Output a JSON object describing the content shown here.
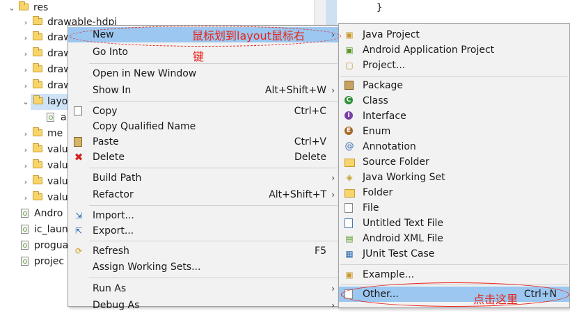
{
  "tree": {
    "items": [
      {
        "label": "res",
        "twisty": "⌄",
        "icon": "folder-icon"
      },
      {
        "label": "drawable-hdpi",
        "twisty": "›",
        "icon": "folder-icon"
      },
      {
        "label": "draw",
        "twisty": "",
        "icon": "folder-icon"
      },
      {
        "label": "draw",
        "twisty": "›",
        "icon": "folder-icon"
      },
      {
        "label": "draw",
        "twisty": "›",
        "icon": "folder-icon"
      },
      {
        "label": "draw",
        "twisty": "›",
        "icon": "folder-icon"
      },
      {
        "label": "layo",
        "twisty": "⌄",
        "icon": "folder-icon"
      },
      {
        "label": "a",
        "twisty": "",
        "icon": "xml-file-icon"
      },
      {
        "label": "me",
        "twisty": "›",
        "icon": "folder-icon"
      },
      {
        "label": "valu",
        "twisty": "›",
        "icon": "folder-icon"
      },
      {
        "label": "valu",
        "twisty": "›",
        "icon": "folder-icon"
      },
      {
        "label": "valu",
        "twisty": "›",
        "icon": "folder-icon"
      },
      {
        "label": "valu",
        "twisty": "›",
        "icon": "folder-icon"
      },
      {
        "label": "Andro",
        "twisty": "",
        "icon": "file-icon"
      },
      {
        "label": "ic_laun",
        "twisty": "",
        "icon": "file-icon"
      },
      {
        "label": "progua",
        "twisty": "",
        "icon": "file-icon"
      },
      {
        "label": "projec",
        "twisty": "",
        "icon": "file-icon"
      }
    ]
  },
  "editor": {
    "brace": "}"
  },
  "context_menu": {
    "items": [
      {
        "label": "New",
        "shortcut": "",
        "submenu": true,
        "icon": ""
      },
      {
        "label": "Go Into",
        "shortcut": "",
        "submenu": false,
        "icon": ""
      },
      {
        "label": "Open in New Window",
        "shortcut": "",
        "submenu": false,
        "icon": ""
      },
      {
        "label": "Show In",
        "shortcut": "Alt+Shift+W",
        "submenu": true,
        "icon": ""
      },
      {
        "label": "Copy",
        "shortcut": "Ctrl+C",
        "submenu": false,
        "icon": "copy-icon"
      },
      {
        "label": "Copy Qualified Name",
        "shortcut": "",
        "submenu": false,
        "icon": ""
      },
      {
        "label": "Paste",
        "shortcut": "Ctrl+V",
        "submenu": false,
        "icon": "paste-icon"
      },
      {
        "label": "Delete",
        "shortcut": "Delete",
        "submenu": false,
        "icon": "delete-icon"
      },
      {
        "label": "Build Path",
        "shortcut": "",
        "submenu": true,
        "icon": ""
      },
      {
        "label": "Refactor",
        "shortcut": "Alt+Shift+T",
        "submenu": true,
        "icon": ""
      },
      {
        "label": "Import...",
        "shortcut": "",
        "submenu": false,
        "icon": "import-icon"
      },
      {
        "label": "Export...",
        "shortcut": "",
        "submenu": false,
        "icon": "export-icon"
      },
      {
        "label": "Refresh",
        "shortcut": "F5",
        "submenu": false,
        "icon": "refresh-icon"
      },
      {
        "label": "Assign Working Sets...",
        "shortcut": "",
        "submenu": false,
        "icon": ""
      },
      {
        "label": "Run As",
        "shortcut": "",
        "submenu": true,
        "icon": ""
      },
      {
        "label": "Debug As",
        "shortcut": "",
        "submenu": true,
        "icon": ""
      }
    ]
  },
  "new_submenu": {
    "items": [
      {
        "label": "Java Project",
        "shortcut": "",
        "icon": "java-project-icon"
      },
      {
        "label": "Android Application Project",
        "shortcut": "",
        "icon": "android-project-icon"
      },
      {
        "label": "Project...",
        "shortcut": "",
        "icon": "project-icon"
      },
      {
        "label": "Package",
        "shortcut": "",
        "icon": "package-icon"
      },
      {
        "label": "Class",
        "shortcut": "",
        "icon": "class-icon"
      },
      {
        "label": "Interface",
        "shortcut": "",
        "icon": "interface-icon"
      },
      {
        "label": "Enum",
        "shortcut": "",
        "icon": "enum-icon"
      },
      {
        "label": "Annotation",
        "shortcut": "",
        "icon": "annotation-icon"
      },
      {
        "label": "Source Folder",
        "shortcut": "",
        "icon": "source-folder-icon"
      },
      {
        "label": "Java Working Set",
        "shortcut": "",
        "icon": "working-set-icon"
      },
      {
        "label": "Folder",
        "shortcut": "",
        "icon": "folder-icon"
      },
      {
        "label": "File",
        "shortcut": "",
        "icon": "file-icon"
      },
      {
        "label": "Untitled Text File",
        "shortcut": "",
        "icon": "text-file-icon"
      },
      {
        "label": "Android XML File",
        "shortcut": "",
        "icon": "android-xml-icon"
      },
      {
        "label": "JUnit Test Case",
        "shortcut": "",
        "icon": "junit-icon"
      },
      {
        "label": "Example...",
        "shortcut": "",
        "icon": "example-icon"
      },
      {
        "label": "Other...",
        "shortcut": "Ctrl+N",
        "icon": "other-icon"
      }
    ]
  },
  "annotations": {
    "mouse_to_layout": "鼠标划到layout鼠标右",
    "key": "键",
    "click_here": "点击这里"
  },
  "colors": {
    "highlight": "#9bc7f0",
    "annotation": "#e8231a",
    "menu_bg": "#f2f2f2"
  }
}
